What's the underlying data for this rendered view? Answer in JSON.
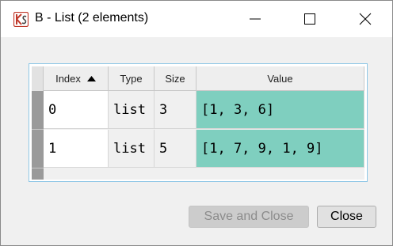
{
  "window": {
    "title": "B - List (2 elements)",
    "app_icon": "spyder-variable-explorer-icon"
  },
  "table": {
    "columns": [
      {
        "label": "Index",
        "sorted": "ascending"
      },
      {
        "label": "Type"
      },
      {
        "label": "Size"
      },
      {
        "label": "Value"
      }
    ],
    "rows": [
      {
        "index": "0",
        "type": "list",
        "size": "3",
        "value": "[1, 3, 6]"
      },
      {
        "index": "1",
        "type": "list",
        "size": "5",
        "value": "[1, 7, 9, 1, 9]"
      }
    ],
    "value_color": "#7fcfbf"
  },
  "buttons": {
    "save_and_close": "Save and Close",
    "close": "Close"
  }
}
